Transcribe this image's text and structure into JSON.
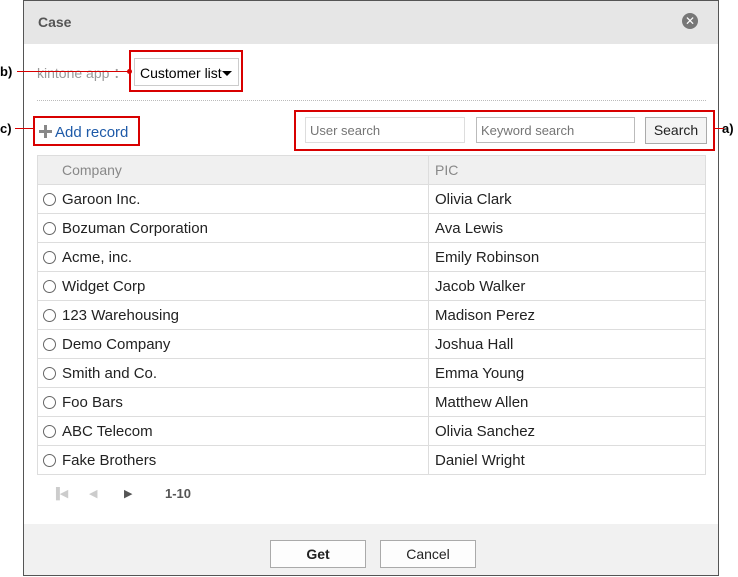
{
  "dialog": {
    "title": "Case",
    "close_icon": "close-icon"
  },
  "app_selector": {
    "label": "kintone app ：",
    "value": "Customer list"
  },
  "toolbar": {
    "add_record_label": "Add record",
    "user_search_placeholder": "User search",
    "keyword_search_placeholder": "Keyword search",
    "search_label": "Search"
  },
  "table": {
    "columns": [
      "Company",
      "PIC"
    ],
    "rows": [
      {
        "company": "Garoon Inc.",
        "pic": "Olivia Clark"
      },
      {
        "company": "Bozuman Corporation",
        "pic": "Ava Lewis"
      },
      {
        "company": "Acme, inc.",
        "pic": "Emily Robinson"
      },
      {
        "company": "Widget Corp",
        "pic": "Jacob Walker"
      },
      {
        "company": "123 Warehousing",
        "pic": "Madison Perez"
      },
      {
        "company": "Demo Company",
        "pic": "Joshua Hall"
      },
      {
        "company": "Smith and Co.",
        "pic": "Emma Young"
      },
      {
        "company": "Foo Bars",
        "pic": "Matthew Allen"
      },
      {
        "company": "ABC Telecom",
        "pic": "Olivia Sanchez"
      },
      {
        "company": "Fake Brothers",
        "pic": "Daniel Wright"
      }
    ]
  },
  "pagination": {
    "range": "1-10"
  },
  "footer": {
    "get_label": "Get",
    "cancel_label": "Cancel"
  },
  "annotations": {
    "a": "a)",
    "b": "b)",
    "c": "c)",
    "color": "#d80000"
  }
}
